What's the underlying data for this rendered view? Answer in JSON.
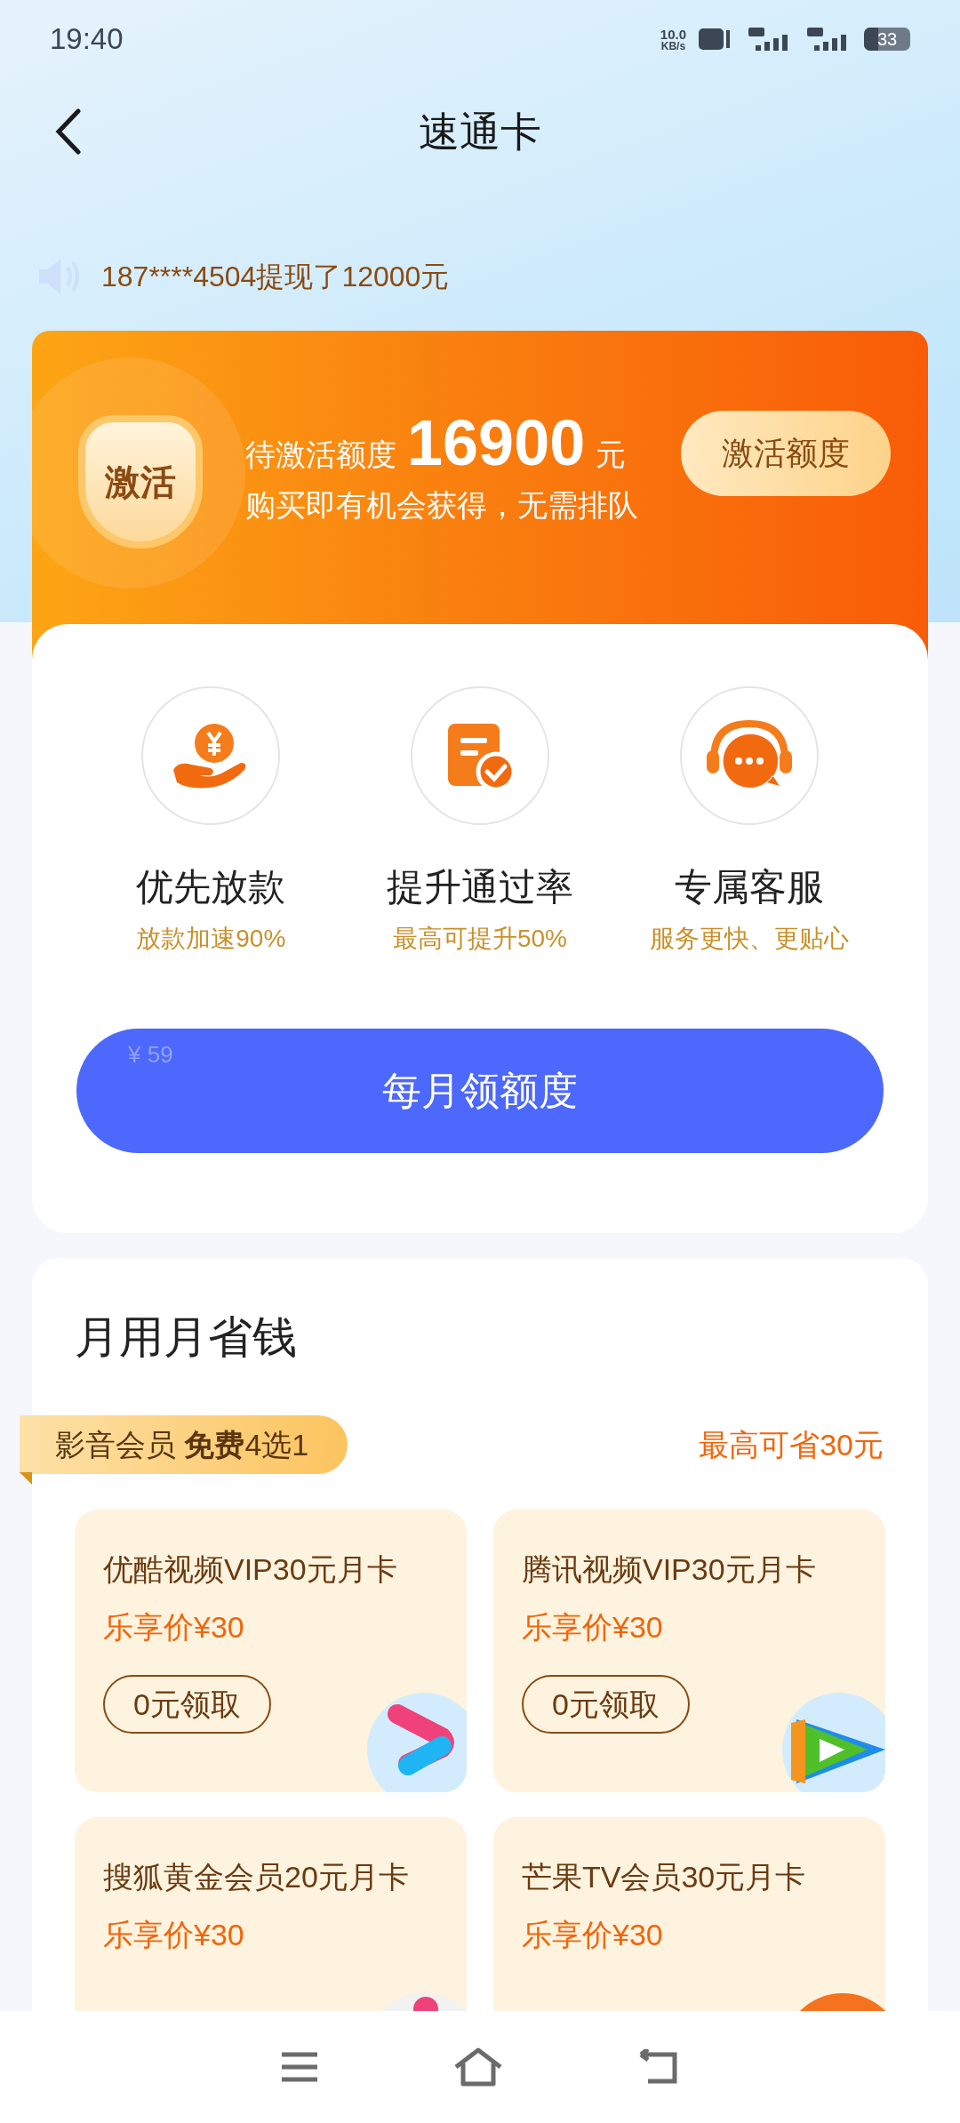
{
  "status_bar": {
    "time": "19:40",
    "speed": "10.0",
    "speed_unit": "KB/s",
    "battery": "33"
  },
  "header": {
    "title": "速通卡"
  },
  "ticker": {
    "text": "187****4504提现了12000元"
  },
  "banner": {
    "badge": "激活",
    "label": "待激活额度",
    "amount": "16900",
    "unit": "元",
    "subtitle": "购买即有机会获得，无需排队",
    "button": "激活额度"
  },
  "features": [
    {
      "kind": "money",
      "title": "优先放款",
      "subtitle": "放款加速90%"
    },
    {
      "kind": "document",
      "title": "提升通过率",
      "subtitle": "最高可提升50%"
    },
    {
      "kind": "service",
      "title": "专属客服",
      "subtitle": "服务更快、更贴心"
    }
  ],
  "cta": {
    "price": "¥ 59",
    "label": "每月领额度"
  },
  "section": {
    "title": "月用月省钱",
    "tag": "影音会员 **免费**4选1",
    "saving": "最高可省30元",
    "products": [
      {
        "name": "优酷视频VIP30元月卡",
        "price": "乐享价¥30",
        "button": "0元领取",
        "kind": "youku"
      },
      {
        "name": "腾讯视频VIP30元月卡",
        "price": "乐享价¥30",
        "button": "0元领取",
        "kind": "tencent"
      },
      {
        "name": "搜狐黄金会员20元月卡",
        "price": "乐享价¥30",
        "kind": "sohu"
      },
      {
        "name": "芒果TV会员30元月卡",
        "price": "乐享价¥30",
        "kind": "mango"
      }
    ]
  }
}
